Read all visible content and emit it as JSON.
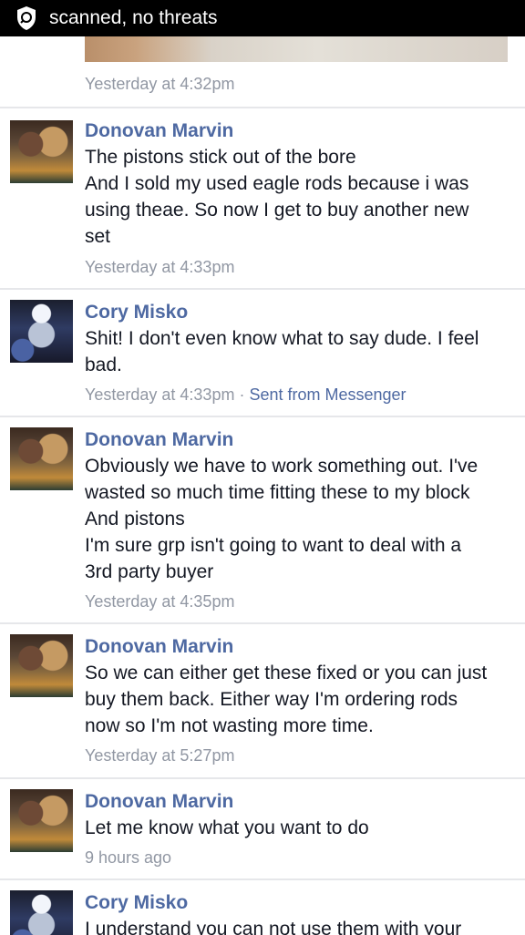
{
  "status_bar": {
    "text": "scanned, no threats",
    "icon": "shield-scan-icon"
  },
  "previous": {
    "time": "Yesterday at 4:32pm"
  },
  "messages": [
    {
      "name": "Donovan Marvin",
      "lines": [
        "The pistons stick out of the bore",
        "And I sold my used eagle rods because i was",
        "using theae. So now I get to buy another new",
        "set"
      ],
      "time": "Yesterday at 4:33pm"
    },
    {
      "name": "Cory Misko",
      "lines": [
        "Shit! I don't even know what to say dude. I feel",
        "bad."
      ],
      "time": "Yesterday at 4:33pm",
      "separator": " · ",
      "via": "Sent from Messenger"
    },
    {
      "name": "Donovan Marvin",
      "lines": [
        "Obviously we have to work something out. I've",
        "wasted so much time fitting these to my block",
        "And pistons",
        "I'm sure grp isn't going to want to deal with a",
        "3rd party buyer"
      ],
      "time": "Yesterday at 4:35pm"
    },
    {
      "name": "Donovan Marvin",
      "lines": [
        "So we can either get these fixed or you can just",
        "buy them back. Either way I'm ordering rods",
        "now so I'm not wasting more time."
      ],
      "time": "Yesterday at 5:27pm"
    },
    {
      "name": "Donovan Marvin",
      "lines": [
        "Let me know what you want to do"
      ],
      "time": "9 hours ago"
    },
    {
      "name": "Cory Misko",
      "lines": [
        "I understand you can not use them with your"
      ]
    }
  ]
}
